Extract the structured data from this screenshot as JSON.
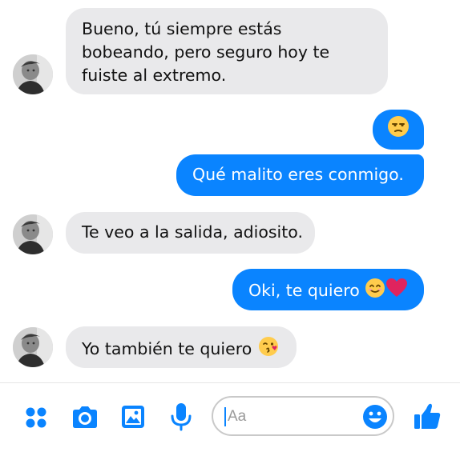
{
  "messages": [
    {
      "from": "them",
      "lines": [
        "Bueno, tú siempre estás",
        "bobeando, pero seguro hoy te",
        "fuiste al extremo."
      ]
    },
    {
      "from": "me",
      "emoji": "unamused-face-emoji"
    },
    {
      "from": "me",
      "text": "Qué malito eres conmigo."
    },
    {
      "from": "them",
      "text": "Te veo a la salida, adiosito."
    },
    {
      "from": "me",
      "text": "Oki, te quiero",
      "emojis": [
        "smiling-face-emoji",
        "red-heart-emoji"
      ]
    },
    {
      "from": "them",
      "text": "Yo también te quiero",
      "emojis": [
        "face-blowing-kiss-emoji"
      ]
    }
  ],
  "composer": {
    "placeholder": "Aa",
    "icons": [
      "more-apps-icon",
      "camera-icon",
      "gallery-icon",
      "microphone-icon",
      "emoji-icon",
      "like-thumbs-up-icon"
    ]
  },
  "colors": {
    "outgoing_bubble": "#0a84ff",
    "incoming_bubble": "#e9e9eb",
    "accent": "#0a84ff"
  }
}
